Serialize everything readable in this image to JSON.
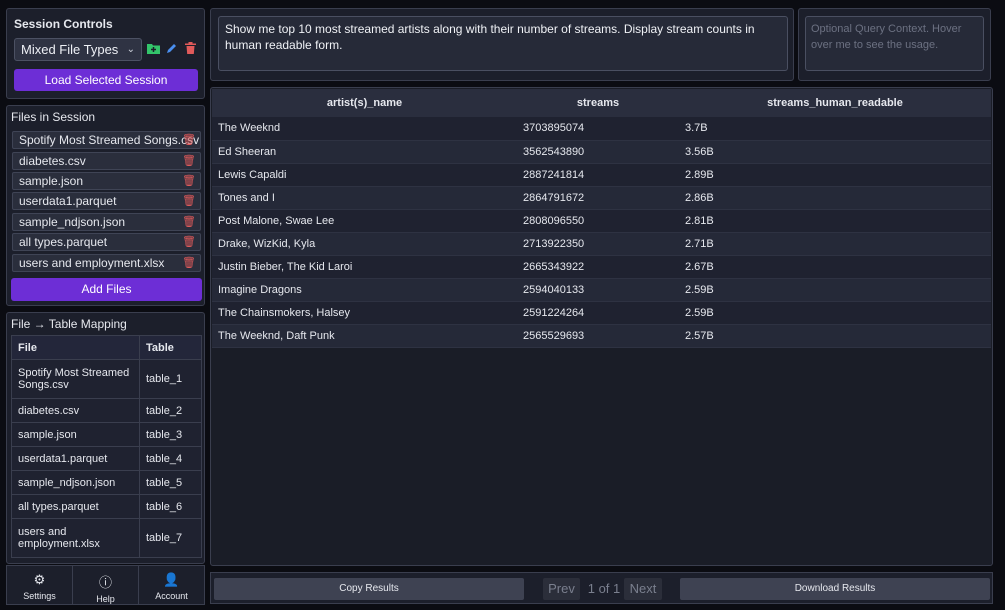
{
  "session": {
    "title": "Session Controls",
    "selected": "Mixed File Types",
    "load_label": "Load Selected Session",
    "icons": [
      "folder-add-icon",
      "pencil-icon",
      "trash-icon"
    ]
  },
  "files": {
    "title": "Files in Session",
    "items": [
      "Spotify Most Streamed Songs.csv",
      "diabetes.csv",
      "sample.json",
      "userdata1.parquet",
      "sample_ndjson.json",
      "all types.parquet",
      "users and employment.xlsx"
    ],
    "add_label": "Add Files"
  },
  "mapping": {
    "title": "File → Table Mapping",
    "headers": [
      "File",
      "Table"
    ],
    "rows": [
      {
        "file": "Spotify Most Streamed Songs.csv",
        "table": "table_1"
      },
      {
        "file": "diabetes.csv",
        "table": "table_2"
      },
      {
        "file": "sample.json",
        "table": "table_3"
      },
      {
        "file": "userdata1.parquet",
        "table": "table_4"
      },
      {
        "file": "sample_ndjson.json",
        "table": "table_5"
      },
      {
        "file": "all types.parquet",
        "table": "table_6"
      },
      {
        "file": "users and employment.xlsx",
        "table": "table_7"
      }
    ]
  },
  "nav": {
    "settings": "Settings",
    "help": "Help",
    "account": "Account"
  },
  "query": {
    "text": "Show me top 10 most streamed artists along with their number of streams. Display stream counts in human readable form.",
    "context_placeholder": "Optional Query Context. Hover over me to see the usage."
  },
  "results": {
    "headers": [
      "artist(s)_name",
      "streams",
      "streams_human_readable"
    ],
    "rows": [
      [
        "The Weeknd",
        "3703895074",
        "3.7B"
      ],
      [
        "Ed Sheeran",
        "3562543890",
        "3.56B"
      ],
      [
        "Lewis Capaldi",
        "2887241814",
        "2.89B"
      ],
      [
        "Tones and I",
        "2864791672",
        "2.86B"
      ],
      [
        "Post Malone, Swae Lee",
        "2808096550",
        "2.81B"
      ],
      [
        "Drake, WizKid, Kyla",
        "2713922350",
        "2.71B"
      ],
      [
        "Justin Bieber, The Kid Laroi",
        "2665343922",
        "2.67B"
      ],
      [
        "Imagine Dragons",
        "2594040133",
        "2.59B"
      ],
      [
        "The Chainsmokers, Halsey",
        "2591224264",
        "2.59B"
      ],
      [
        "The Weeknd, Daft Punk",
        "2565529693",
        "2.57B"
      ]
    ]
  },
  "footer": {
    "copy_label": "Copy Results",
    "prev_label": "Prev",
    "page_indicator": "1 of 1",
    "next_label": "Next",
    "download_label": "Download Results"
  },
  "colors": {
    "accent": "#6d2ed6",
    "delete": "#e05a5a",
    "folder_icon": "#33c46a",
    "pencil_icon": "#4a8ff0"
  }
}
